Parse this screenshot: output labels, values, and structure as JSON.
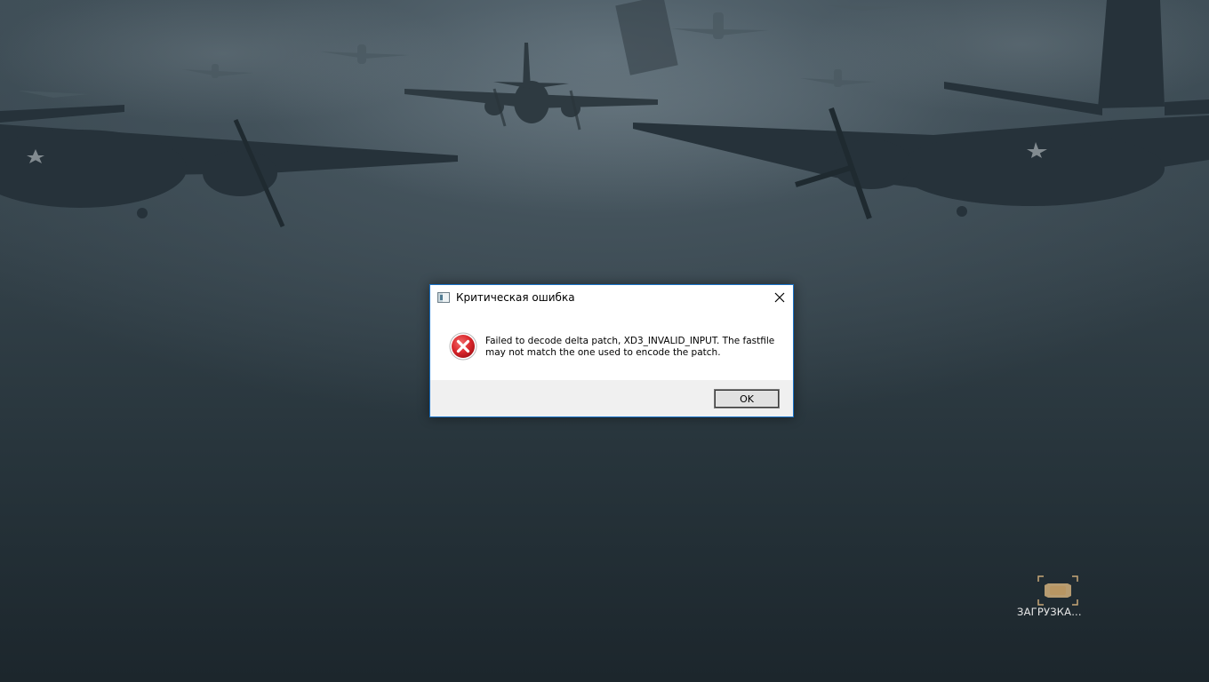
{
  "background": {
    "description_icon": "bomber-planes-background"
  },
  "dialog": {
    "title": "Критическая ошибка",
    "message": "Failed to decode delta patch, XD3_INVALID_INPUT. The fastfile may not match the one used to encode the patch.",
    "ok_label": "OK",
    "icons": {
      "app": "application-window-icon",
      "error": "error-x-icon",
      "close": "close-icon"
    },
    "colors": {
      "border": "#1a73c9",
      "error_red": "#d9262b",
      "footer": "#f0f0f0"
    }
  },
  "loading": {
    "label": "ЗАГРУЗКА...",
    "icon": "loading-brackets-icon",
    "accent": "#c8a878"
  }
}
